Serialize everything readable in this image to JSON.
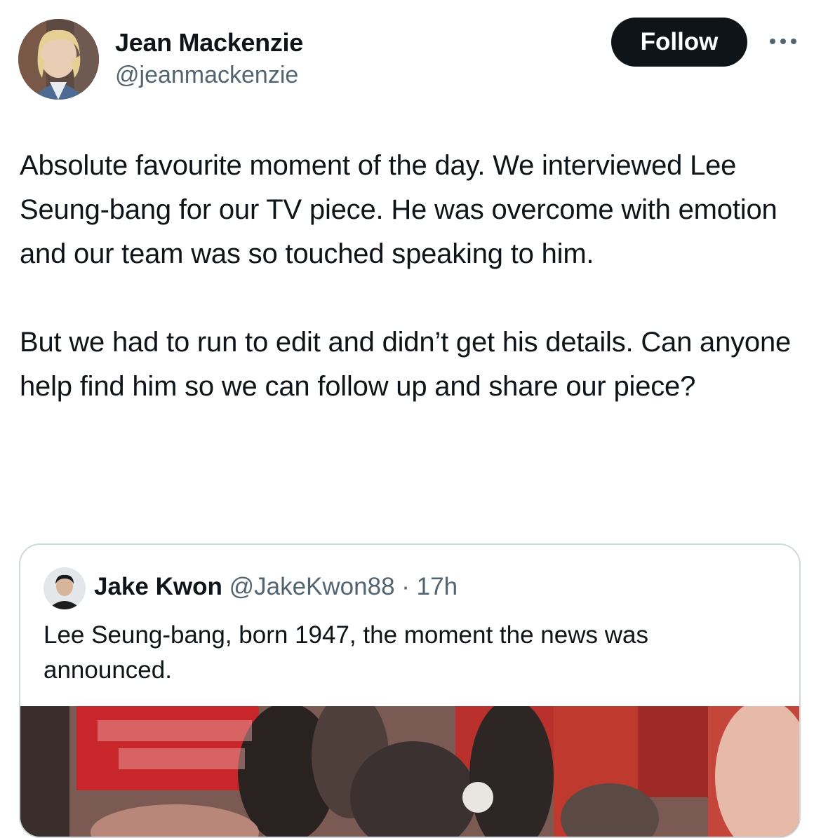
{
  "author": {
    "name": "Jean Mackenzie",
    "handle": "@jeanmackenzie",
    "avatar_icon": "profile-photo"
  },
  "header": {
    "follow_label": "Follow",
    "more_icon": "more-options-icon"
  },
  "tweet": {
    "text": "Absolute favourite moment of the day. We interviewed Lee Seung-bang for our TV piece. He was overcome with emotion and our team was so touched speaking to him.\n\nBut we had to run to edit and didn’t get his details. Can anyone help find him so we can follow up and share our piece?"
  },
  "quoted_tweet": {
    "name": "Jake Kwon",
    "handle": "@JakeKwon88",
    "separator": "·",
    "time": "17h",
    "text": "Lee Seung-bang, born 1947, the moment the news was announced.",
    "media_icon": "video-thumbnail"
  },
  "colors": {
    "text_primary": "#0f1419",
    "text_secondary": "#536471",
    "border": "#cfd9de",
    "follow_bg": "#0f1419"
  }
}
